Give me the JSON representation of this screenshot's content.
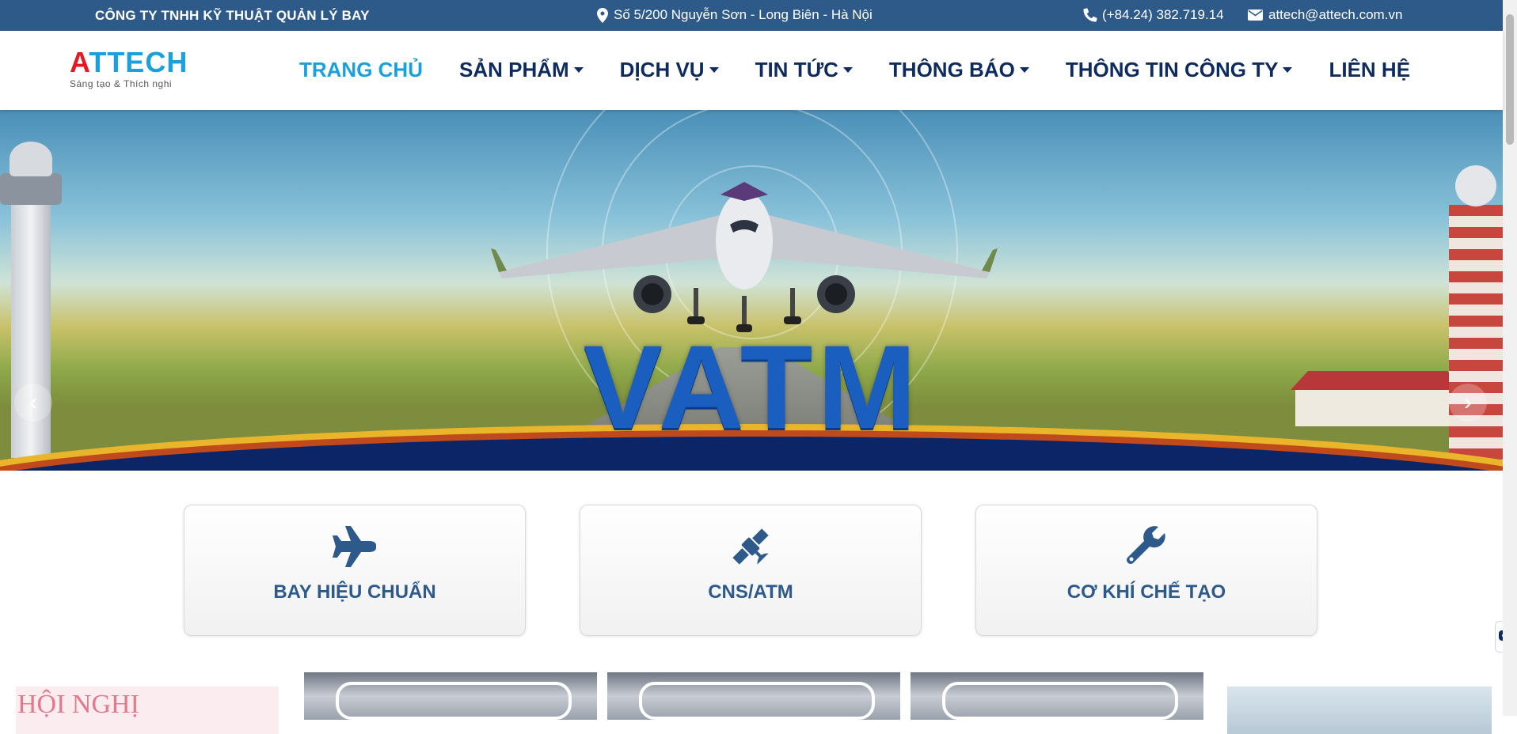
{
  "topbar": {
    "company": "CÔNG TY TNHH KỸ THUẬT QUẢN LÝ BAY",
    "address": "Số 5/200 Nguyễn Sơn - Long Biên - Hà Nội",
    "phone": "(+84.24) 382.719.14",
    "email": "attech@attech.com.vn",
    "icons": [
      "map-marker-icon",
      "phone-icon",
      "envelope-icon"
    ]
  },
  "logo": {
    "first_letter": "A",
    "rest": "TTECH",
    "slogan": "Sáng tạo & Thích nghi",
    "colors": {
      "first_letter": "#e01b22",
      "rest": "#1aa0df"
    }
  },
  "nav": {
    "items": [
      {
        "label": "TRANG CHỦ",
        "active": true,
        "dropdown": false
      },
      {
        "label": "SẢN PHẨM",
        "active": false,
        "dropdown": true
      },
      {
        "label": "DỊCH VỤ",
        "active": false,
        "dropdown": true
      },
      {
        "label": "TIN TỨC",
        "active": false,
        "dropdown": true
      },
      {
        "label": "THÔNG BÁO",
        "active": false,
        "dropdown": true
      },
      {
        "label": "THÔNG TIN CÔNG TY",
        "active": false,
        "dropdown": true
      },
      {
        "label": "LIÊN HỆ",
        "active": false,
        "dropdown": false
      }
    ],
    "colors": {
      "active": "#1aa0df",
      "default": "#0d2b5e"
    }
  },
  "hero": {
    "banner_text": "VATM",
    "prev_label": "‹",
    "next_label": "›"
  },
  "services": [
    {
      "label": "BAY HIỆU CHUẨN",
      "icon": "plane-icon"
    },
    {
      "label": "CNS/ATM",
      "icon": "satellite-icon"
    },
    {
      "label": "CƠ KHÍ CHẾ TẠO",
      "icon": "wrench-icon"
    }
  ],
  "news_strip": {
    "first_banner_text": "HỘI NGHỊ"
  },
  "colors": {
    "topbar_bg": "#2e5a8a",
    "service_label": "#2d5a8a"
  }
}
